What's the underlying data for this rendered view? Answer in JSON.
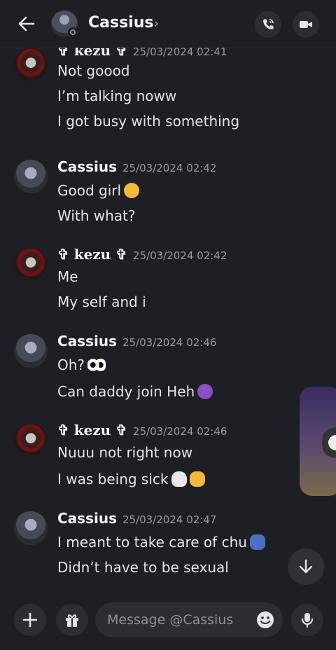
{
  "header": {
    "contact_name": "Cassius",
    "chevron": "›",
    "icons": [
      "back-arrow-icon",
      "voice-call-icon",
      "video-call-icon"
    ]
  },
  "messages": [
    {
      "author": "✞ kezu ✞",
      "timestamp": "25/03/2024 02:41",
      "lines": [
        "Not goood",
        "I’m talking noww",
        "I got busy with something"
      ]
    },
    {
      "author": "Cassius",
      "timestamp": "25/03/2024 02:42",
      "lines": [
        "Good girl",
        "With what?"
      ],
      "emojis": [
        "kissing-face-emoji"
      ]
    },
    {
      "author": "✞ kezu ✞",
      "timestamp": "25/03/2024 02:42",
      "lines": [
        "Me",
        "My self and i"
      ]
    },
    {
      "author": "Cassius",
      "timestamp": "25/03/2024 02:46",
      "lines": [
        "Oh?",
        "Can daddy join Heh"
      ],
      "emojis": [
        "eyes-emoji",
        "smiling-devil-emoji"
      ]
    },
    {
      "author": "✞ kezu ✞",
      "timestamp": "25/03/2024 02:46",
      "lines": [
        "Nuuu not right now",
        "I was being sick"
      ],
      "emojis": [
        "skull-emoji",
        "clapping-hands-emoji"
      ]
    },
    {
      "author": "Cassius",
      "timestamp": "25/03/2024 02:47",
      "lines": [
        "I meant to take care of chu",
        "Didn’t have to be sexual"
      ],
      "emojis": [
        "person-shrugging-emoji"
      ]
    }
  ],
  "composer": {
    "placeholder": "Message @Cassius",
    "icons": [
      "add-icon",
      "gift-icon",
      "emoji-icon",
      "microphone-icon"
    ]
  },
  "colors": {
    "background": "#1e1f24",
    "text": "#e3e5e8",
    "muted": "#949ba4",
    "button": "#2b2d33"
  }
}
